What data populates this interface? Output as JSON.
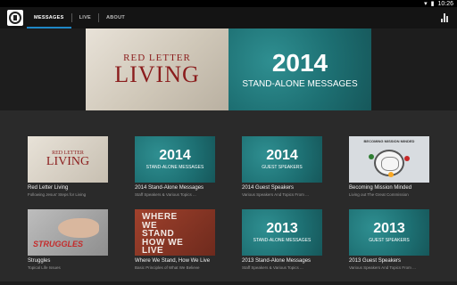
{
  "status": {
    "time": "10:26"
  },
  "tabs": [
    {
      "label": "MESSAGES"
    },
    {
      "label": "LIVE"
    },
    {
      "label": "ABOUT"
    }
  ],
  "hero": {
    "left_small": "RED LETTER",
    "left_big": "LIVING",
    "right_year": "2014",
    "right_sub": "STAND-ALONE MESSAGES"
  },
  "cards": [
    {
      "title": "Red Letter Living",
      "subtitle": "Following Jesus' Steps for Living",
      "art_small": "RED LETTER",
      "art_big": "LIVING"
    },
    {
      "title": "2014 Stand-Alone Messages",
      "subtitle": "Staff Speakers & Various Topics ...",
      "art_year": "2014",
      "art_sub": "STAND-ALONE MESSAGES"
    },
    {
      "title": "2014 Guest Speakers",
      "subtitle": "Various Speakers And Topics From ...",
      "art_year": "2014",
      "art_sub": "GUEST SPEAKERS"
    },
    {
      "title": "Becoming Mission Minded",
      "subtitle": "Living out The Great Commission",
      "art_head": "BECOMING MISSION MINDED"
    },
    {
      "title": "Struggles",
      "subtitle": "Topical Life Issues",
      "art_word": "STRUGGLES"
    },
    {
      "title": "Where We Stand, How We Live",
      "subtitle": "Basic Principles of What We Believe",
      "art_lines": [
        "WHERE",
        "WE",
        "STAND",
        "HOW WE",
        "LIVE"
      ]
    },
    {
      "title": "2013 Stand-Alone Messages",
      "subtitle": "Staff Speakers & Various Topics ...",
      "art_year": "2013",
      "art_sub": "STAND-ALONE MESSAGES"
    },
    {
      "title": "2013 Guest Speakers",
      "subtitle": "Various Speakers And Topics From ...",
      "art_year": "2013",
      "art_sub": "GUEST SPEAKERS"
    }
  ]
}
